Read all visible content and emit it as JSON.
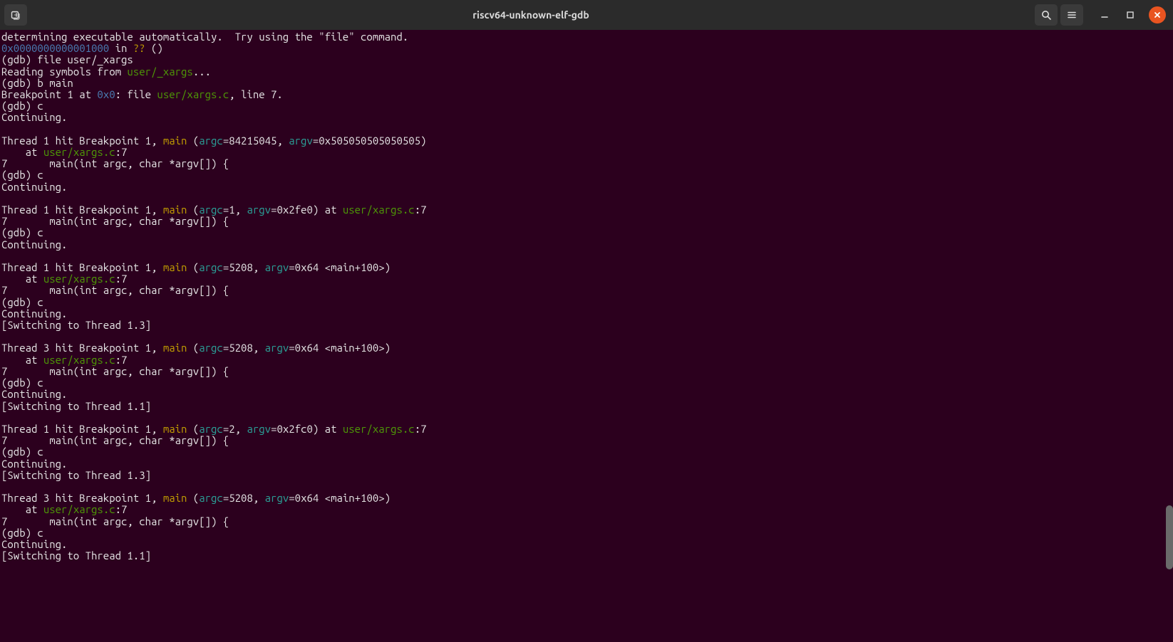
{
  "titlebar": {
    "title": "riscv64-unknown-elf-gdb"
  },
  "lines": [
    [
      [
        "w",
        "determining executable automatically.  Try using the \"file\" command."
      ]
    ],
    [
      [
        "b",
        "0x0000000000001000"
      ],
      [
        "w",
        " in "
      ],
      [
        "y",
        "??"
      ],
      [
        "w",
        " ()"
      ]
    ],
    [
      [
        "w",
        "(gdb) file user/_xargs"
      ]
    ],
    [
      [
        "w",
        "Reading symbols from "
      ],
      [
        "g",
        "user/_xargs"
      ],
      [
        "w",
        "..."
      ]
    ],
    [
      [
        "w",
        "(gdb) b main"
      ]
    ],
    [
      [
        "w",
        "Breakpoint 1 at "
      ],
      [
        "b",
        "0x0"
      ],
      [
        "w",
        ": file "
      ],
      [
        "g",
        "user/xargs.c"
      ],
      [
        "w",
        ", line 7."
      ]
    ],
    [
      [
        "w",
        "(gdb) c"
      ]
    ],
    [
      [
        "w",
        "Continuing."
      ]
    ],
    [
      [
        "w",
        ""
      ]
    ],
    [
      [
        "w",
        "Thread 1 hit Breakpoint 1, "
      ],
      [
        "y",
        "main"
      ],
      [
        "w",
        " ("
      ],
      [
        "c",
        "argc"
      ],
      [
        "w",
        "=84215045, "
      ],
      [
        "c",
        "argv"
      ],
      [
        "w",
        "=0x505050505050505)"
      ]
    ],
    [
      [
        "w",
        "    at "
      ],
      [
        "g",
        "user/xargs.c"
      ],
      [
        "w",
        ":7"
      ]
    ],
    [
      [
        "w",
        "7       main(int argc, char *argv[]) {"
      ]
    ],
    [
      [
        "w",
        "(gdb) c"
      ]
    ],
    [
      [
        "w",
        "Continuing."
      ]
    ],
    [
      [
        "w",
        ""
      ]
    ],
    [
      [
        "w",
        "Thread 1 hit Breakpoint 1, "
      ],
      [
        "y",
        "main"
      ],
      [
        "w",
        " ("
      ],
      [
        "c",
        "argc"
      ],
      [
        "w",
        "=1, "
      ],
      [
        "c",
        "argv"
      ],
      [
        "w",
        "=0x2fe0) at "
      ],
      [
        "g",
        "user/xargs.c"
      ],
      [
        "w",
        ":7"
      ]
    ],
    [
      [
        "w",
        "7       main(int argc, char *argv[]) {"
      ]
    ],
    [
      [
        "w",
        "(gdb) c"
      ]
    ],
    [
      [
        "w",
        "Continuing."
      ]
    ],
    [
      [
        "w",
        ""
      ]
    ],
    [
      [
        "w",
        "Thread 1 hit Breakpoint 1, "
      ],
      [
        "y",
        "main"
      ],
      [
        "w",
        " ("
      ],
      [
        "c",
        "argc"
      ],
      [
        "w",
        "=5208, "
      ],
      [
        "c",
        "argv"
      ],
      [
        "w",
        "=0x64 <main+100>)"
      ]
    ],
    [
      [
        "w",
        "    at "
      ],
      [
        "g",
        "user/xargs.c"
      ],
      [
        "w",
        ":7"
      ]
    ],
    [
      [
        "w",
        "7       main(int argc, char *argv[]) {"
      ]
    ],
    [
      [
        "w",
        "(gdb) c"
      ]
    ],
    [
      [
        "w",
        "Continuing."
      ]
    ],
    [
      [
        "w",
        "[Switching to Thread 1.3]"
      ]
    ],
    [
      [
        "w",
        ""
      ]
    ],
    [
      [
        "w",
        "Thread 3 hit Breakpoint 1, "
      ],
      [
        "y",
        "main"
      ],
      [
        "w",
        " ("
      ],
      [
        "c",
        "argc"
      ],
      [
        "w",
        "=5208, "
      ],
      [
        "c",
        "argv"
      ],
      [
        "w",
        "=0x64 <main+100>)"
      ]
    ],
    [
      [
        "w",
        "    at "
      ],
      [
        "g",
        "user/xargs.c"
      ],
      [
        "w",
        ":7"
      ]
    ],
    [
      [
        "w",
        "7       main(int argc, char *argv[]) {"
      ]
    ],
    [
      [
        "w",
        "(gdb) c"
      ]
    ],
    [
      [
        "w",
        "Continuing."
      ]
    ],
    [
      [
        "w",
        "[Switching to Thread 1.1]"
      ]
    ],
    [
      [
        "w",
        ""
      ]
    ],
    [
      [
        "w",
        "Thread 1 hit Breakpoint 1, "
      ],
      [
        "y",
        "main"
      ],
      [
        "w",
        " ("
      ],
      [
        "c",
        "argc"
      ],
      [
        "w",
        "=2, "
      ],
      [
        "c",
        "argv"
      ],
      [
        "w",
        "=0x2fc0) at "
      ],
      [
        "g",
        "user/xargs.c"
      ],
      [
        "w",
        ":7"
      ]
    ],
    [
      [
        "w",
        "7       main(int argc, char *argv[]) {"
      ]
    ],
    [
      [
        "w",
        "(gdb) c"
      ]
    ],
    [
      [
        "w",
        "Continuing."
      ]
    ],
    [
      [
        "w",
        "[Switching to Thread 1.3]"
      ]
    ],
    [
      [
        "w",
        ""
      ]
    ],
    [
      [
        "w",
        "Thread 3 hit Breakpoint 1, "
      ],
      [
        "y",
        "main"
      ],
      [
        "w",
        " ("
      ],
      [
        "c",
        "argc"
      ],
      [
        "w",
        "=5208, "
      ],
      [
        "c",
        "argv"
      ],
      [
        "w",
        "=0x64 <main+100>)"
      ]
    ],
    [
      [
        "w",
        "    at "
      ],
      [
        "g",
        "user/xargs.c"
      ],
      [
        "w",
        ":7"
      ]
    ],
    [
      [
        "w",
        "7       main(int argc, char *argv[]) {"
      ]
    ],
    [
      [
        "w",
        "(gdb) c"
      ]
    ],
    [
      [
        "w",
        "Continuing."
      ]
    ],
    [
      [
        "w",
        "[Switching to Thread 1.1]"
      ]
    ],
    [
      [
        "w",
        ""
      ]
    ]
  ]
}
